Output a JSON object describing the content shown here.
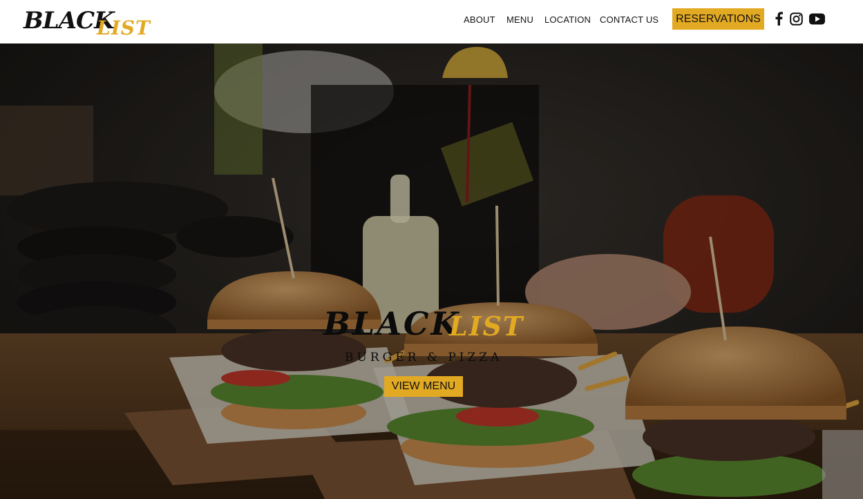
{
  "brand": {
    "word1": "BLACK",
    "word2": "LIST"
  },
  "nav": {
    "items": [
      "ABOUT",
      "MENU",
      "LOCATION",
      "CONTACT US"
    ],
    "reservations": "RESERVATIONS"
  },
  "social": [
    {
      "icon": "facebook-icon"
    },
    {
      "icon": "instagram-icon"
    },
    {
      "icon": "youtube-icon"
    }
  ],
  "hero": {
    "brand_word1": "BLACK",
    "brand_word2": "LIST",
    "tagline": "BURGER & PIZZA",
    "cta": "VIEW MENU"
  },
  "colors": {
    "accent": "#e2a923",
    "dark": "#111111",
    "header_bg": "#ffffff"
  }
}
